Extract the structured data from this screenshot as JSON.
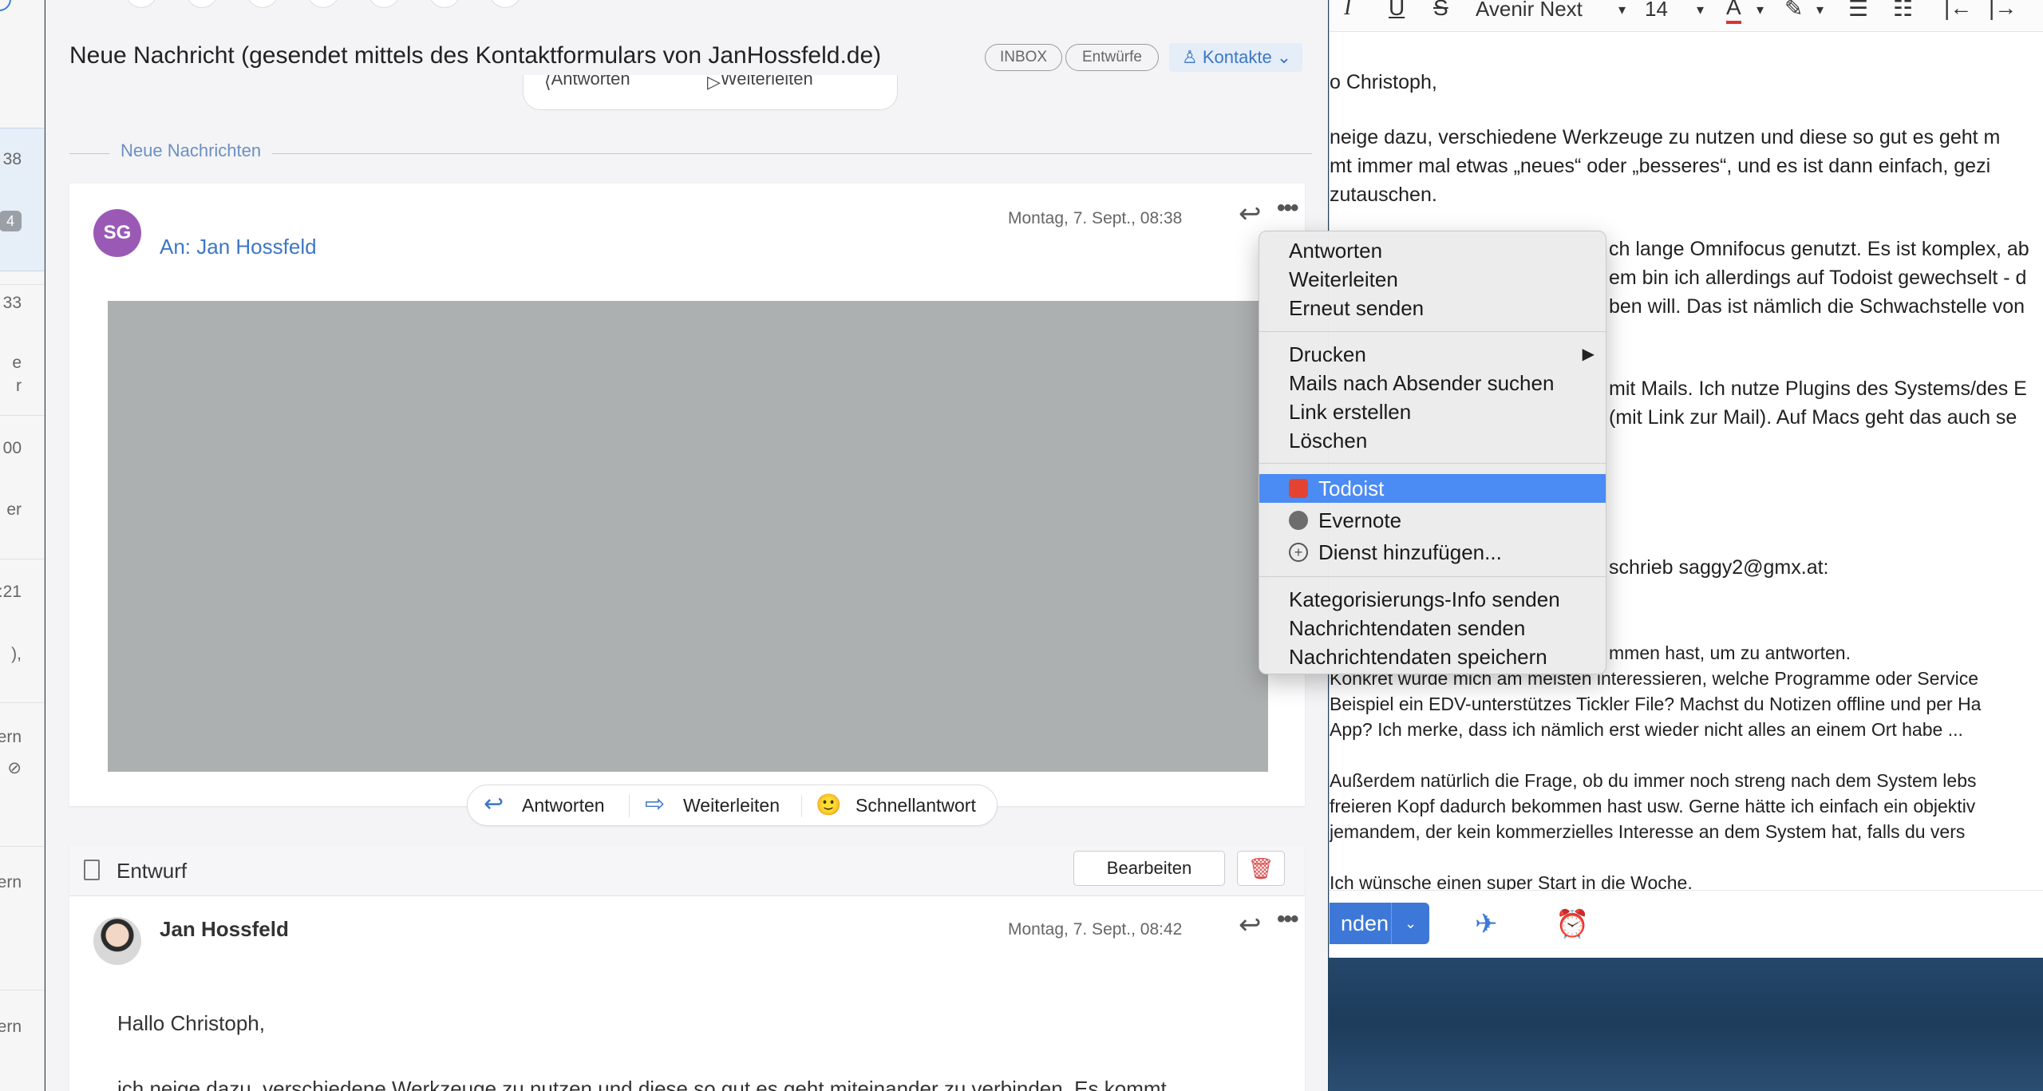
{
  "mail_list": {
    "times": [
      "38",
      "33",
      "00",
      ":21"
    ],
    "badge": "4",
    "fragments": [
      "e",
      "r",
      "er",
      "),",
      "ern",
      "ern",
      "ern"
    ]
  },
  "message": {
    "subject": "Neue Nachricht (gesendet mittels des Kontaktformulars von JanHossfeld.de)",
    "tags": [
      "INBOX",
      "Entwürfe"
    ],
    "contacts_button": "Kontakte",
    "ghost_reply": "Antworten",
    "ghost_forward": "Weiterleiten",
    "new_messages_label": "Neue Nachrichten",
    "sender_initials": "SG",
    "to_line": "An: Jan Hossfeld",
    "date": "Montag, 7. Sept., 08:38"
  },
  "actions": {
    "reply": "Antworten",
    "forward": "Weiterleiten",
    "quick_reply": "Schnellantwort"
  },
  "draft": {
    "label": "Entwurf",
    "edit_button": "Bearbeiten",
    "sender": "Jan Hossfeld",
    "date": "Montag, 7. Sept., 08:42",
    "greeting": "Hallo Christoph,",
    "body_line": "ich neige dazu, verschiedene Werkzeuge zu nutzen und diese so gut es geht miteinander zu verbinden. Es kommt"
  },
  "compose": {
    "font_name": "Avenir Next",
    "font_size": "14",
    "lines": [
      "o Christoph,",
      "neige dazu, verschiedene Werkzeuge zu nutzen und diese so gut es geht m",
      "mt immer mal etwas „neues“ oder „besseres“, und es ist dann einfach, gezi",
      "zutauschen.",
      "ch lange Omnifocus genutzt. Es ist komplex, ab",
      "em bin ich allerdings auf Todoist gewechselt - d",
      "ben will. Das ist nämlich die Schwachstelle von",
      "mit Mails. Ich nutze Plugins des Systems/des E",
      "(mit Link zur Mail). Auf Macs geht das auch se",
      "schrieb saggy2@gmx.at:",
      "mmen hast, um zu antworten.",
      "Konkret würde mich am meisten interessieren, welche Programme oder Service",
      "Beispiel ein EDV-unterstützes Tickler File? Machst du Notizen offline und per Ha",
      "App? Ich merke, dass ich nämlich erst wieder nicht alles an einem Ort habe ...",
      "Außerdem natürlich die Frage, ob du immer noch streng nach dem System lebs",
      "freieren Kopf dadurch bekommen hast usw. Gerne hätte ich einfach ein objektiv",
      "jemandem, der kein kommerzielles Interesse an dem System hat, falls du vers",
      "Ich wünsche einen super Start in die Woche."
    ],
    "send_label": "nden"
  },
  "context_menu": {
    "group1": [
      "Antworten",
      "Weiterleiten",
      "Erneut senden"
    ],
    "group2": [
      "Drucken",
      "Mails nach Absender suchen",
      "Link erstellen",
      "Löschen"
    ],
    "group3": [
      "Todoist",
      "Evernote",
      "Dienst hinzufügen..."
    ],
    "group4": [
      "Kategorisierungs-Info senden",
      "Nachrichtendaten senden",
      "Nachrichtendaten speichern"
    ],
    "highlighted": "Todoist"
  },
  "colors": {
    "accent": "#3d77c4",
    "highlight": "#4b8bf4",
    "avatar_sg": "#9b59b6",
    "danger": "#d94a4a"
  }
}
